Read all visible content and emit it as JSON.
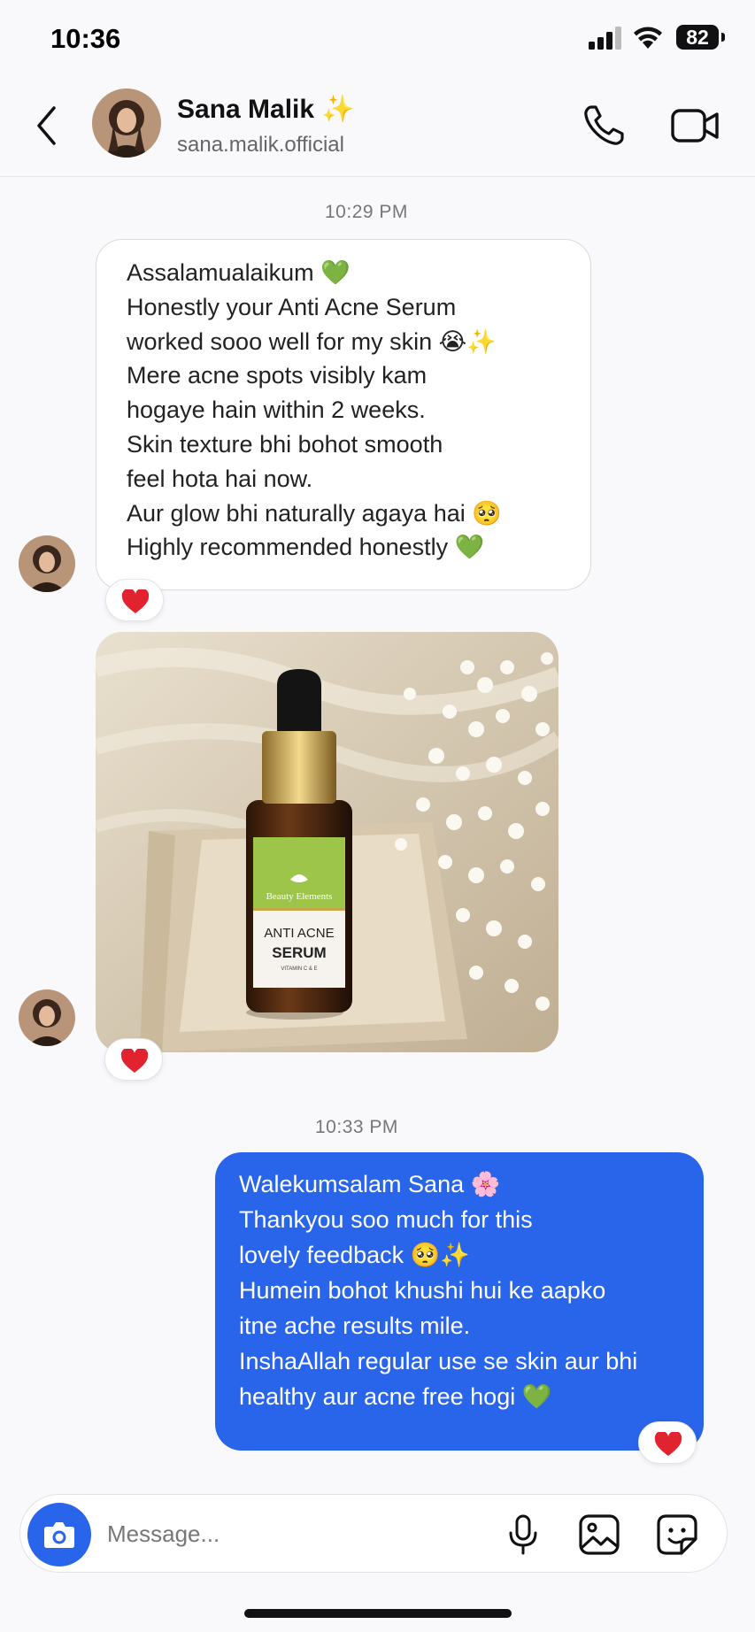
{
  "status_bar": {
    "time": "10:36",
    "battery": "82"
  },
  "contact": {
    "name": "Sana Malik ✨",
    "handle": "sana.malik.official"
  },
  "messages": [
    {
      "timestamp": "10:29 PM",
      "direction": "incoming",
      "lines": [
        "Assalamualaikum 💚",
        "Honestly your Anti Acne Serum",
        "worked sooo well for my skin 😭✨",
        "Mere acne spots visibly kam",
        "hogaye hain within 2 weeks.",
        "Skin texture bhi bohot smooth",
        "feel hota hai now.",
        "Aur glow bhi naturally agaya hai 🥺",
        "Highly recommended honestly 💚"
      ],
      "reaction": "❤️"
    },
    {
      "direction": "incoming",
      "type": "photo",
      "photo": {
        "brand": "Beauty Elements",
        "product_line1": "ANTI ACNE",
        "product_line2": "SERUM",
        "product_line3": "VITAMIN C & E"
      },
      "reaction": "❤️"
    },
    {
      "timestamp": "10:33 PM",
      "direction": "outgoing",
      "lines": [
        "Walekumsalam Sana 🌸",
        "Thankyou soo much for this",
        "lovely feedback 🥺✨",
        "Humein bohot khushi hui ke aapko",
        "itne ache results mile.",
        "InshaAllah regular use se skin aur bhi",
        "healthy aur acne free hogi 💚"
      ],
      "reaction": "❤️"
    }
  ],
  "composer": {
    "placeholder": "Message..."
  },
  "colors": {
    "accent": "#2965ea",
    "background": "#f9f9fb",
    "reaction_heart": "#e0232f"
  }
}
